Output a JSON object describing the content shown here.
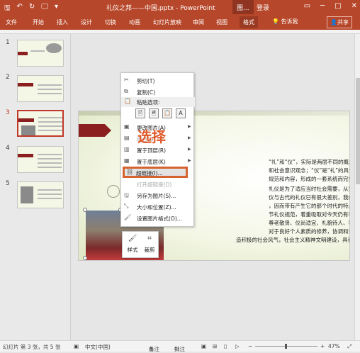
{
  "titlebar": {
    "qa_save": "🖫",
    "qa_undo": "↶",
    "qa_redo": "↻",
    "qa_present": "🖵",
    "qa_more": "▾",
    "title": "礼仪之邦——中国.pptx - PowerPoint",
    "context_tab": "图...",
    "login": "登录",
    "win_restore": "▭",
    "win_min": "─",
    "win_max": "□",
    "win_close": "✕"
  },
  "ribbon": {
    "tabs": [
      "文件",
      "开始",
      "插入",
      "设计",
      "切换",
      "动画",
      "幻灯片放映",
      "审阅",
      "视图",
      "格式"
    ],
    "active_tab": "格式",
    "tell_me": "告诉我",
    "share": "共享"
  },
  "thumbnails": [
    {
      "num": "1"
    },
    {
      "num": "2"
    },
    {
      "num": "3"
    },
    {
      "num": "4"
    },
    {
      "num": "5"
    }
  ],
  "slide": {
    "lines": [
      "“礼”和“仪”，实际是两层不同的概念。“礼”",
      "和社会意识观念；“仪”是“礼”的具体表现形式，",
      "规范和内容，形成的一套系统而完整的程序。",
      "礼仪是为了适应当时社会需要，从宗族制度、等",
      "仪与古代的礼仪已有很大差别，我们必须摒弃那些",
      "，因而带有产生它的那个时代的特点及局限性。时",
      "节礼仪规范，着重吸取对今天仍有积极、普遍意义的",
      "尊老敬贤、仪尚适宜、礼貌待人、容仪有整等，加",
      "对于良好个人素质的修养，协调和谐人际关系，塑",
      "造积极的社会风气，社会主义精神文明建设，具有现代价值。"
    ]
  },
  "context_menu": {
    "items": [
      {
        "label": "剪切(T)",
        "icon": "scissors-icon",
        "glyph": "✂"
      },
      {
        "label": "复制(C)",
        "icon": "copy-icon",
        "glyph": "⧉"
      },
      {
        "label": "粘贴选项:",
        "icon": "paste-icon",
        "glyph": "📋"
      },
      {
        "label": "更改图片(A)",
        "icon": "change-picture-icon",
        "glyph": "▣"
      },
      {
        "label": "组合(G)",
        "icon": "group-icon",
        "glyph": "▤"
      },
      {
        "label": "置于顶层(R)",
        "icon": "bring-front-icon",
        "glyph": "▥"
      },
      {
        "label": "置于底层(K)",
        "icon": "send-back-icon",
        "glyph": "▦"
      },
      {
        "label": "超链接(I)...",
        "icon": "hyperlink-icon",
        "glyph": "⛓"
      },
      {
        "label": "另存为图片(S)...",
        "icon": "save-picture-icon",
        "glyph": "🖫"
      },
      {
        "label": "大小和位置(Z)...",
        "icon": "size-position-icon",
        "glyph": "⤡"
      },
      {
        "label": "设置图片格式(O)...",
        "icon": "format-picture-icon",
        "glyph": "🖌"
      }
    ],
    "paste_glyphs": [
      "🖹",
      "🖻",
      "📋",
      "A"
    ],
    "disabled_label": "打开超链接(O)",
    "highlighted": "超链接(I)..."
  },
  "overlay": {
    "label": "选择"
  },
  "mini_toolbar": {
    "style_label": "样式",
    "crop_label": "裁剪",
    "style_glyph": "🖌",
    "crop_glyph": "⌗"
  },
  "statusbar": {
    "slide_info": "幻灯片 第 3 张，共 5 张",
    "language": "中文(中国)",
    "notes": "备注",
    "comments": "批注",
    "zoom_minus": "−",
    "zoom_plus": "+",
    "zoom": "47%"
  }
}
